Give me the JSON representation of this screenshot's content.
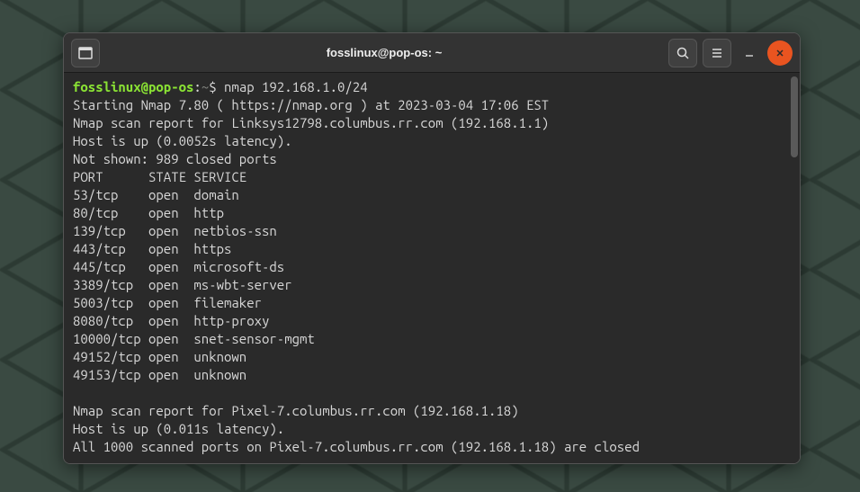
{
  "titlebar": {
    "title": "fosslinux@pop-os: ~"
  },
  "prompt": {
    "user_host": "fosslinux@pop-os",
    "separator": ":",
    "path": "~",
    "symbol": "$ ",
    "command": "nmap 192.168.1.0/24"
  },
  "output": {
    "line1": "Starting Nmap 7.80 ( https://nmap.org ) at 2023-03-04 17:06 EST",
    "line2": "Nmap scan report for Linksys12798.columbus.rr.com (192.168.1.1)",
    "line3": "Host is up (0.0052s latency).",
    "line4": "Not shown: 989 closed ports",
    "header": "PORT      STATE SERVICE",
    "ports": [
      "53/tcp    open  domain",
      "80/tcp    open  http",
      "139/tcp   open  netbios-ssn",
      "443/tcp   open  https",
      "445/tcp   open  microsoft-ds",
      "3389/tcp  open  ms-wbt-server",
      "5003/tcp  open  filemaker",
      "8080/tcp  open  http-proxy",
      "10000/tcp open  snet-sensor-mgmt",
      "49152/tcp open  unknown",
      "49153/tcp open  unknown"
    ],
    "blank": "",
    "line5": "Nmap scan report for Pixel-7.columbus.rr.com (192.168.1.18)",
    "line6": "Host is up (0.011s latency).",
    "line7": "All 1000 scanned ports on Pixel-7.columbus.rr.com (192.168.1.18) are closed"
  }
}
